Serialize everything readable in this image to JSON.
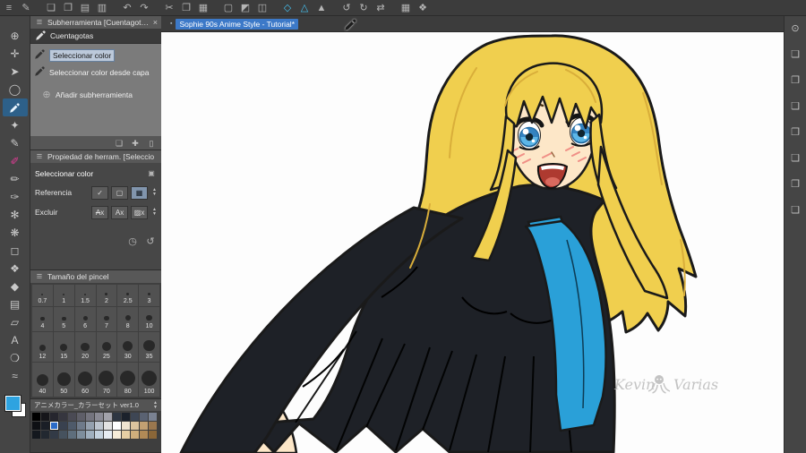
{
  "app": {
    "accent": "#2ea3e0",
    "panel_bg": "#474747"
  },
  "titlebar": {
    "groups": [
      {
        "icons": [
          "menu-icon",
          "edit-pencil-icon"
        ]
      },
      {
        "icons": [
          "new-doc-icon",
          "open-doc-icon",
          "save-icon",
          "save-all-icon"
        ]
      },
      {
        "icons": [
          "undo-icon",
          "redo-icon"
        ]
      },
      {
        "icons": [
          "cut-icon",
          "copy-icon",
          "paste-icon"
        ]
      },
      {
        "icons": [
          "deselect-icon",
          "invert-select-icon",
          "select-border-icon"
        ]
      },
      {
        "icons": [
          "snap-off-icon",
          "snap-ruler-icon",
          "snap-special-icon"
        ]
      },
      {
        "icons": [
          "rotate-left-icon",
          "rotate-right-icon",
          "flip-icon"
        ]
      },
      {
        "icons": [
          "grid-icon",
          "material-icon"
        ]
      }
    ],
    "highlighted": [
      "snap-off-icon",
      "snap-ruler-icon"
    ]
  },
  "tool_strip": {
    "main_color": "#2ea3e0",
    "sub_color": "#ffffff",
    "tools": [
      {
        "name": "zoom-tool"
      },
      {
        "name": "hand-tool"
      },
      {
        "name": "operation-tool"
      },
      {
        "name": "selection-tool"
      },
      {
        "name": "eyedropper-tool",
        "active": true
      },
      {
        "name": "auto-select-tool"
      },
      {
        "name": "pen-tool"
      },
      {
        "name": "marker-tool",
        "color": "#e23c96"
      },
      {
        "name": "pencil-tool"
      },
      {
        "name": "brush-tool"
      },
      {
        "name": "airbrush-tool"
      },
      {
        "name": "decoration-tool"
      },
      {
        "name": "eraser-tool"
      },
      {
        "name": "blend-tool"
      },
      {
        "name": "fill-tool"
      },
      {
        "name": "gradient-tool"
      },
      {
        "name": "figure-tool"
      },
      {
        "name": "text-tool"
      },
      {
        "name": "balloon-tool"
      },
      {
        "name": "line-correct-tool"
      }
    ]
  },
  "subtool_panel": {
    "title": "Subherramienta [Cuentagotas]",
    "group_tab": "Cuentagotas",
    "items": [
      {
        "label": "Seleccionar color",
        "selected": true
      },
      {
        "label": "Seleccionar color desde capa",
        "selected": false
      }
    ],
    "add_label": "Añadir subherramienta"
  },
  "tool_property_panel": {
    "title": "Propiedad de herram. [Seleccio",
    "subtitle": "Seleccionar color",
    "rows": [
      {
        "label": "Referencia"
      },
      {
        "label": "Excluir"
      }
    ]
  },
  "brush_size_panel": {
    "title": "Tamaño del pincel",
    "sizes": [
      "0.7",
      "1",
      "1.5",
      "2",
      "2.5",
      "3",
      "4",
      "5",
      "6",
      "7",
      "8",
      "10",
      "12",
      "15",
      "20",
      "25",
      "30",
      "35",
      "40",
      "50",
      "60",
      "70",
      "80",
      "100"
    ]
  },
  "color_set_panel": {
    "title": "アニメカラー_カラーセット ver1.0",
    "selected_index": 16,
    "swatches": [
      "#000000",
      "#16161a",
      "#26262e",
      "#36363f",
      "#4a4a54",
      "#5e5e68",
      "#74747e",
      "#8a8a94",
      "#a2a2aa",
      "#2e3642",
      "#1c222c",
      "#3e4654",
      "#5a6272",
      "#7a8292",
      "#0e1014",
      "#1a1e26",
      "#2b6bc8",
      "#39414f",
      "#4e5a6a",
      "#6e7a8a",
      "#94a0ae",
      "#bcc4ce",
      "#e2e2e2",
      "#ffffff",
      "#f0e4d0",
      "#dcc49e",
      "#c2a072",
      "#9a774e",
      "#14181e",
      "#222830",
      "#323a46",
      "#46525e",
      "#5e6e7c",
      "#7e8e9c",
      "#a0b0be",
      "#c4d2de",
      "#e6ecf2",
      "#f6ecd8",
      "#e6cfa4",
      "#cfae7c",
      "#b18a56",
      "#8a6638"
    ]
  },
  "canvas": {
    "tab_title": "Sophie 90s Anime Style - Tutorial*",
    "watermark_first": "Kevin",
    "watermark_last": "Varias",
    "art_colors": {
      "hair": "#f0cf4e",
      "hair_shade": "#d9ae3a",
      "skin": "#fde7c8",
      "eye": "#5cb6e8",
      "eye_dark": "#2d7ab8",
      "outfit": "#1e2127",
      "tie": "#2aa0d8",
      "blush": "#f08f86",
      "mouth": "#ae3a30",
      "outline": "#1a1a1a"
    }
  },
  "right_strip": {
    "icons": [
      "navigator-icon",
      "material-color-panel-icon",
      "material-monochrome-panel-icon",
      "material-manga-panel-icon",
      "material-image-panel-icon",
      "material-3d-panel-icon",
      "download-panel-icon",
      "history-panel-icon"
    ]
  }
}
